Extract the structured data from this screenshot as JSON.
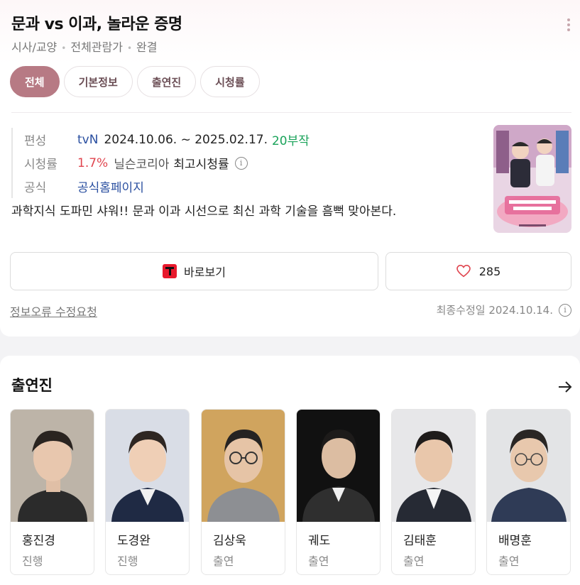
{
  "header": {
    "title": "문과 vs 이과, 놀라운 증명",
    "meta": [
      "시사/교양",
      "전체관람가",
      "완결"
    ]
  },
  "tabs": [
    {
      "label": "전체",
      "active": true
    },
    {
      "label": "기본정보",
      "active": false
    },
    {
      "label": "출연진",
      "active": false
    },
    {
      "label": "시청률",
      "active": false
    }
  ],
  "info": {
    "broadcast_label": "편성",
    "channel": "tvN",
    "period": "2024.10.06. ~ 2025.02.17.",
    "episodes": "20부작",
    "rating_label": "시청률",
    "rating_value": "1.7%",
    "rating_source": "닐슨코리아",
    "rating_note": "최고시청률",
    "official_label": "공식",
    "official_link": "공식홈페이지"
  },
  "description": "과학지식 도파민 샤워!! 문과 이과 시선으로 최신 과학 기술을 흠뻑 맞아본다.",
  "actions": {
    "watch_label": "바로보기",
    "like_count": "285"
  },
  "footer": {
    "report_label": "정보오류 수정요청",
    "updated_label": "최종수정일 2024.10.14."
  },
  "cast_section": {
    "title": "출연진",
    "members": [
      {
        "name": "홍진경",
        "role": "진행"
      },
      {
        "name": "도경완",
        "role": "진행"
      },
      {
        "name": "김상욱",
        "role": "출연"
      },
      {
        "name": "궤도",
        "role": "출연"
      },
      {
        "name": "김태훈",
        "role": "출연"
      },
      {
        "name": "배명훈",
        "role": "출연"
      }
    ]
  },
  "colors": {
    "accent": "#b77a84",
    "link_blue": "#2a4fa0",
    "episodes_green": "#1aa35a",
    "rating_red": "#e0454f",
    "brand_red": "#e8192c"
  }
}
